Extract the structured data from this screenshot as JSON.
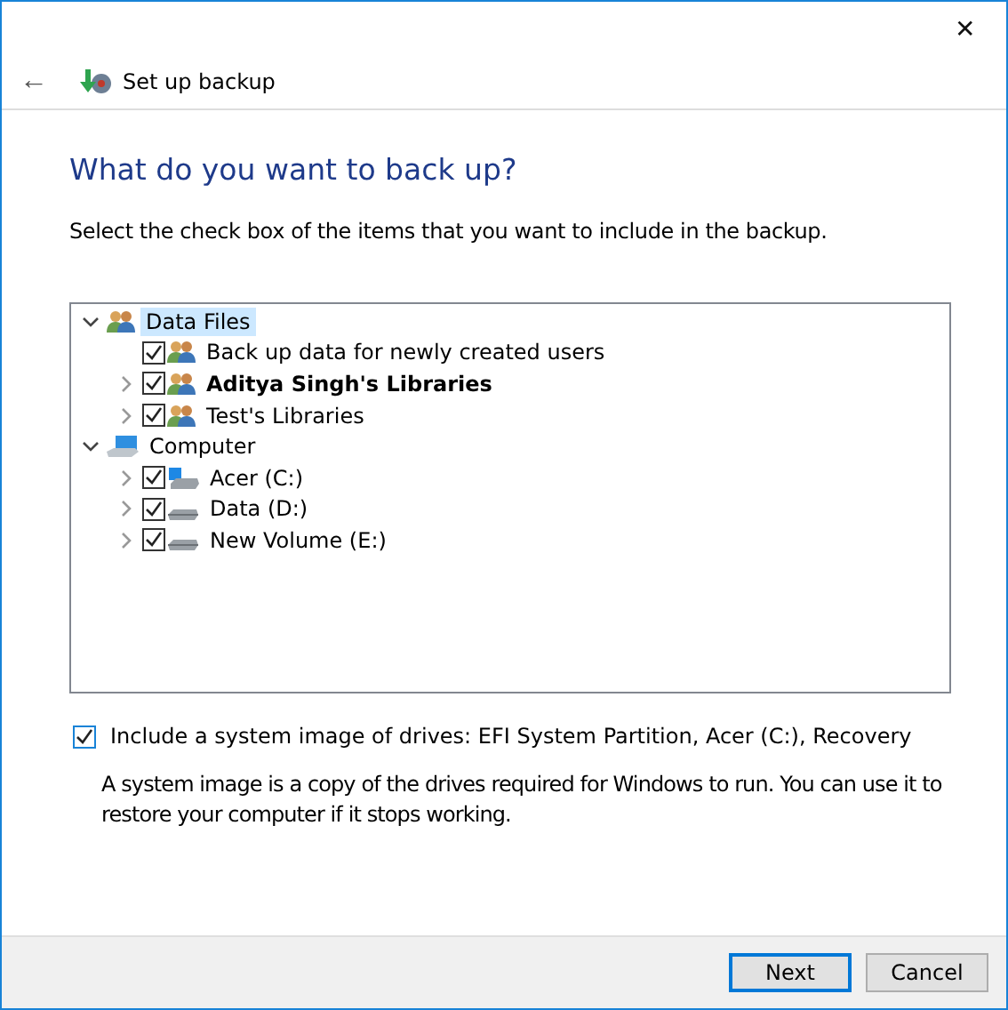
{
  "window": {
    "title": "Set up backup",
    "close": "✕",
    "back": "←"
  },
  "heading": "What do you want to back up?",
  "instruction": "Select the check box of the items that you want to include in the backup.",
  "tree": [
    {
      "label": "Data Files",
      "kind": "users",
      "expanded": true,
      "selected": true,
      "children": [
        {
          "label": "Back up data for newly created users",
          "kind": "users",
          "checked": true,
          "selected": false,
          "bold": false
        },
        {
          "label": "Aditya Singh's Libraries",
          "kind": "users",
          "checked": true,
          "expanded": false,
          "selected": false,
          "bold": true
        },
        {
          "label": "Test's Libraries",
          "kind": "users",
          "checked": true,
          "expanded": false,
          "selected": false,
          "bold": false
        }
      ]
    },
    {
      "label": "Computer",
      "kind": "computer",
      "expanded": true,
      "selected": false,
      "children": [
        {
          "label": "Acer (C:)",
          "kind": "system-drive",
          "checked": true,
          "expanded": false,
          "selected": false,
          "bold": false
        },
        {
          "label": "Data (D:)",
          "kind": "drive",
          "checked": true,
          "expanded": false,
          "selected": false,
          "bold": false
        },
        {
          "label": "New Volume (E:)",
          "kind": "drive",
          "checked": true,
          "expanded": false,
          "selected": false,
          "bold": false
        }
      ]
    }
  ],
  "system_image": {
    "label": "Include a system image of drives: EFI System Partition, Acer (C:), Recovery",
    "checked": true,
    "description": "A system image is a copy of the drives required for Windows to run. You can use it to restore your computer if it stops working."
  },
  "buttons": [
    {
      "label": "Next",
      "default": true
    },
    {
      "label": "Cancel",
      "default": false
    }
  ]
}
